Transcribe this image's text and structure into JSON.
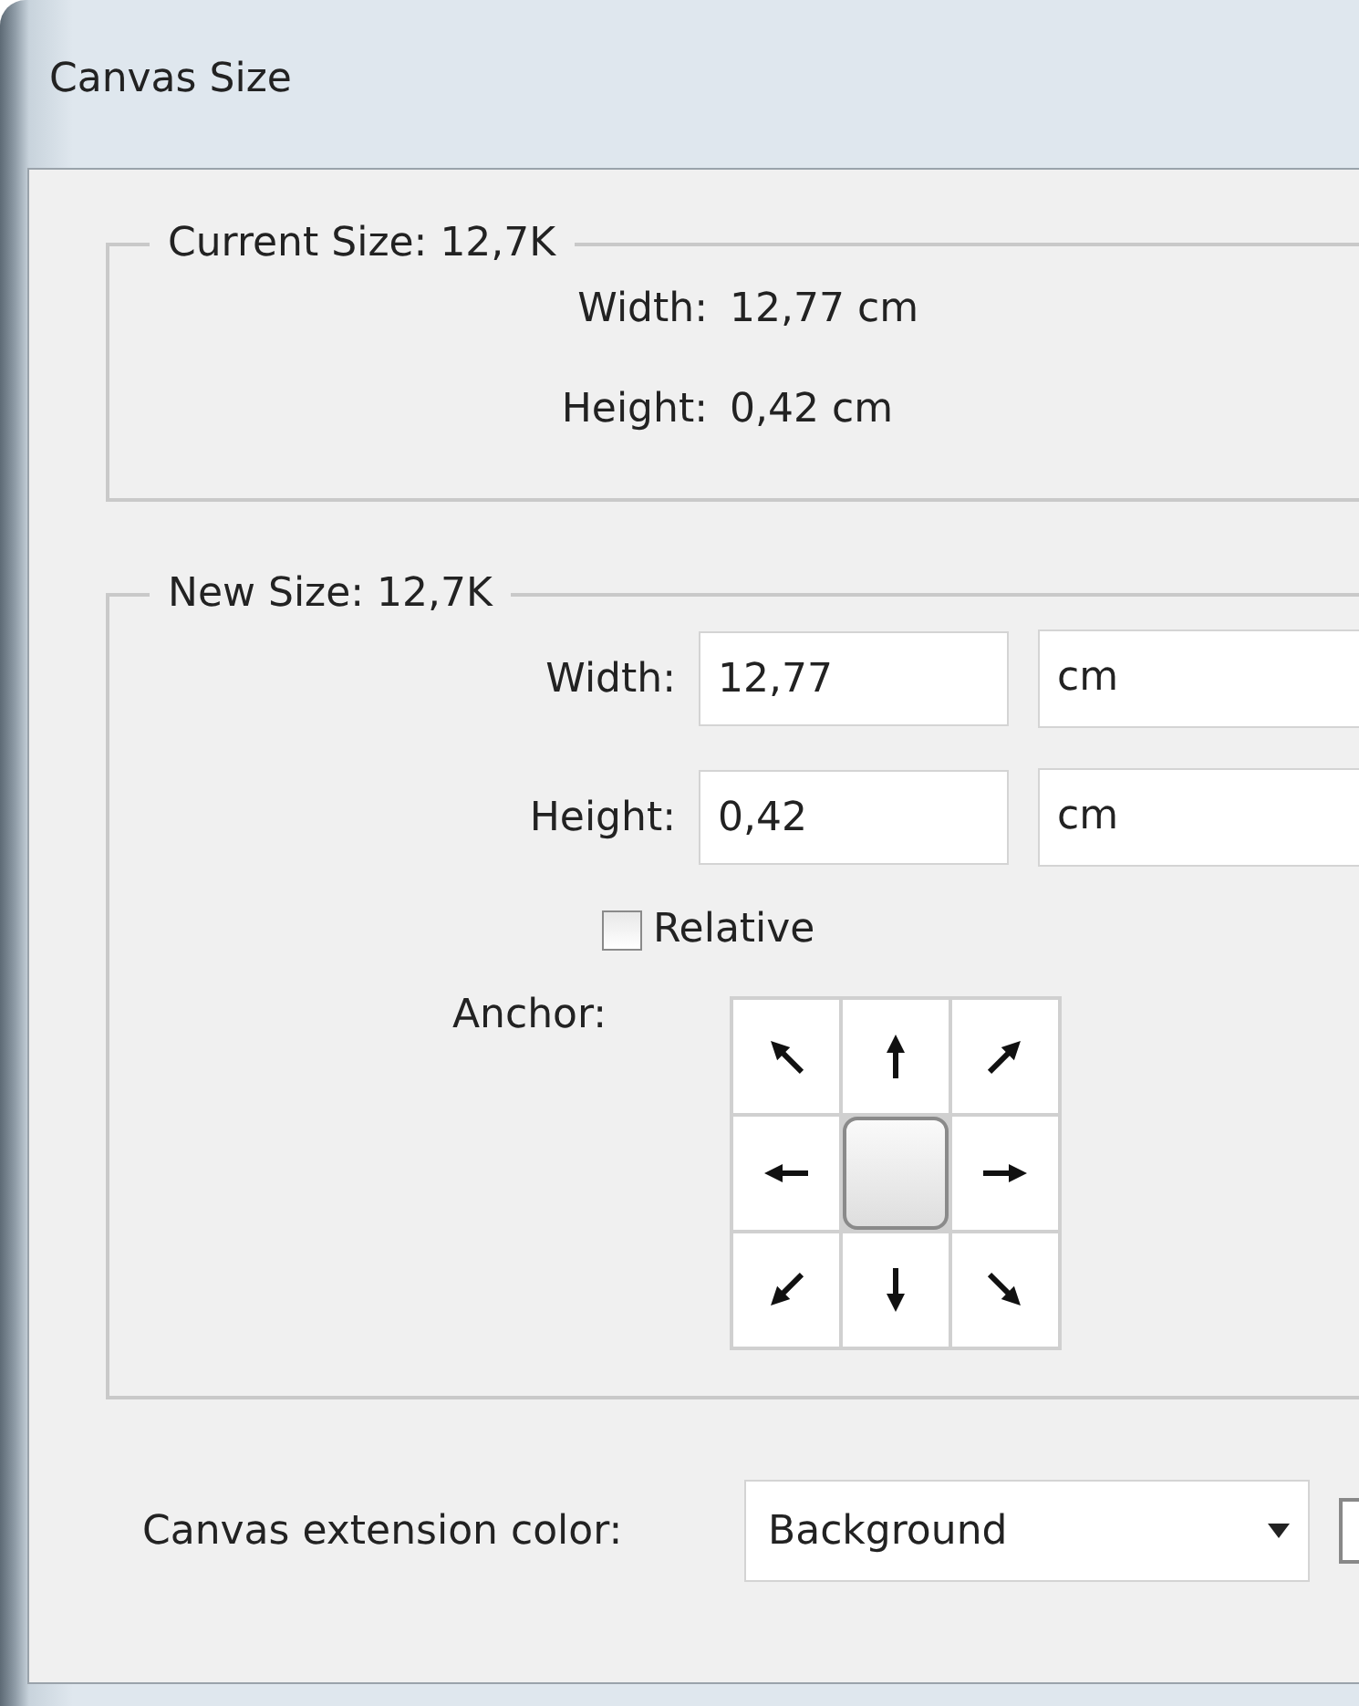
{
  "window": {
    "title": "Canvas Size"
  },
  "current_size": {
    "legend": "Current Size: 12,7K",
    "width_label": "Width:",
    "width_value": "12,77 cm",
    "height_label": "Height:",
    "height_value": "0,42 cm"
  },
  "new_size": {
    "legend": "New Size: 12,7K",
    "width_label": "Width:",
    "width_value": "12,77",
    "width_unit": "cm",
    "height_label": "Height:",
    "height_value": "0,42",
    "height_unit": "cm",
    "relative": {
      "label": "Relative",
      "checked": false
    },
    "anchor_label": "Anchor:",
    "anchor_cells": [
      {
        "kind": "nw",
        "selected": false
      },
      {
        "kind": "n",
        "selected": false
      },
      {
        "kind": "ne",
        "selected": false
      },
      {
        "kind": "w",
        "selected": false
      },
      {
        "kind": "center",
        "selected": true
      },
      {
        "kind": "e",
        "selected": false
      },
      {
        "kind": "sw",
        "selected": false
      },
      {
        "kind": "s",
        "selected": false
      },
      {
        "kind": "se",
        "selected": false
      }
    ]
  },
  "extension_color": {
    "label": "Canvas extension color:",
    "value": "Background"
  }
}
